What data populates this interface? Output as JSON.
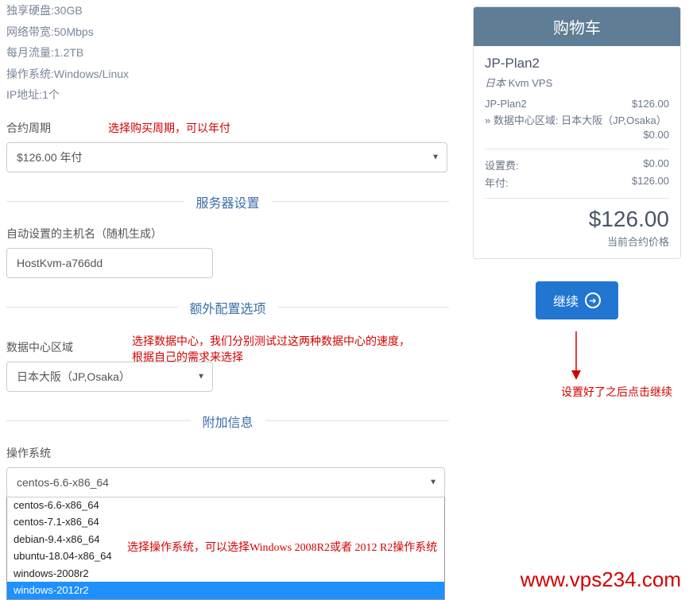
{
  "specs": {
    "disk": "独享硬盘:30GB",
    "bandwidth": "网络带宽:50Mbps",
    "traffic": "每月流量:1.2TB",
    "os": "操作系统:Windows/Linux",
    "ip": "IP地址:1个"
  },
  "billing": {
    "label": "合约周期",
    "selected": "$126.00 年付"
  },
  "sections": {
    "server": "服务器设置",
    "extra": "额外配置选项",
    "additional": "附加信息"
  },
  "hostname": {
    "label": "自动设置的主机名（随机生成）",
    "value": "HostKvm-a766dd"
  },
  "datacenter": {
    "label": "数据中心区域",
    "selected": "日本大阪（JP,Osaka）"
  },
  "oscfg": {
    "label": "操作系统",
    "selected": "centos-6.6-x86_64",
    "options": [
      "centos-6.6-x86_64",
      "centos-7.1-x86_64",
      "debian-9.4-x86_64",
      "ubuntu-18.04-x86_64",
      "windows-2008r2",
      "windows-2012r2"
    ]
  },
  "annotations": {
    "billing": "选择购买周期，可以年付",
    "dc_line1": "选择数据中心，我们分别测试过这两种数据中心的速度，",
    "dc_line2": "根据自己的需求来选择",
    "os": "选择操作系统，可以选择Windows 2008R2或者 2012 R2操作系统",
    "continue": "设置好了之后点击继续"
  },
  "cart": {
    "title": "购物车",
    "plan_name": "JP-Plan2",
    "plan_sub_italic": "日本",
    "plan_sub_rest": " Kvm VPS",
    "line_item": "JP-Plan2",
    "line_price": "$126.00",
    "dc_line": "» 数据中心区域: 日本大阪（JP,Osaka）",
    "dc_price": "$0.00",
    "setup_label": "设置费:",
    "setup_price": "$0.00",
    "yearly_label": "年付:",
    "yearly_price": "$126.00",
    "total": "$126.00",
    "total_label": "当前合约价格"
  },
  "continue_btn": "继续",
  "watermark": "www.vps234.com"
}
